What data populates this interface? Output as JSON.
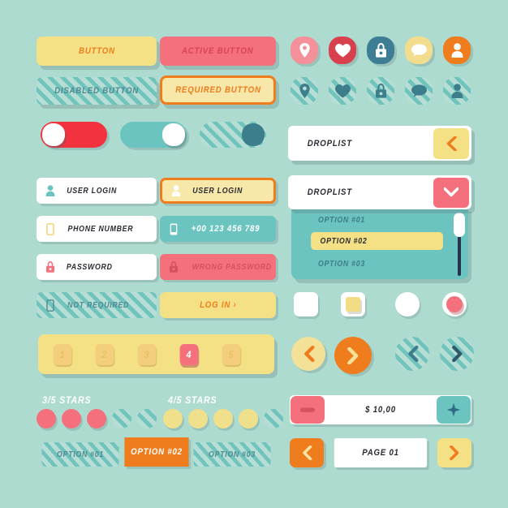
{
  "theme": {
    "background": "#aedbd0",
    "yellow": "#f4e185",
    "pink": "#f4707c",
    "orange": "#f07d1d",
    "teal": "#6bc4bf",
    "teal_dark": "#3d7e87",
    "white": "#ffffff",
    "stripe_light": "#b6ded5",
    "stripe_dark": "#71c3bd"
  },
  "buttons": {
    "normal": "BUTTON",
    "active": "ACTIVE BUTTON",
    "disabled": "DISABLED BUTTON",
    "required": "REQUIRED BUTTON"
  },
  "icons": {
    "enabled": [
      {
        "name": "pin-icon",
        "label": "location",
        "color": "#f4909a"
      },
      {
        "name": "heart-icon",
        "label": "favorite",
        "color": "#d9404d"
      },
      {
        "name": "lock-icon",
        "label": "lock",
        "color": "#3d7e94"
      },
      {
        "name": "chat-icon",
        "label": "message",
        "color": "#f2dd8e"
      },
      {
        "name": "user-icon",
        "label": "profile",
        "color": "#f07d1d"
      }
    ],
    "disabled_note": "disabled striped versions of the same five icons"
  },
  "toggles": [
    {
      "name": "toggle-on-red",
      "state": "off",
      "track": "#f2323f",
      "knob": "#ffffff"
    },
    {
      "name": "toggle-teal",
      "state": "on",
      "track": "#6bc4bf",
      "knob": "#ffffff"
    },
    {
      "name": "toggle-disabled",
      "state": "on",
      "track": "striped",
      "knob": "#3d7e8c"
    }
  ],
  "fields": {
    "left": [
      {
        "name": "user-login-field",
        "label": "USER LOGIN",
        "icon": "user-icon",
        "state": "default"
      },
      {
        "name": "phone-number-field",
        "label": "PHONE NUMBER",
        "icon": "phone-icon",
        "state": "default"
      },
      {
        "name": "password-field",
        "label": "PASSWORD",
        "icon": "lock-icon",
        "state": "default"
      },
      {
        "name": "not-required-field",
        "label": "NOT REQUIRED",
        "icon": "phone-icon",
        "state": "disabled"
      }
    ],
    "right": [
      {
        "name": "user-login-field-focused",
        "label": "USER LOGIN",
        "icon": "user-icon",
        "state": "focused"
      },
      {
        "name": "phone-number-field-filled",
        "label": "+00 123 456 789",
        "icon": "phone-icon",
        "state": "filled"
      },
      {
        "name": "password-field-error",
        "label": "WRONG PASSWORD",
        "icon": "lock-icon",
        "state": "error"
      },
      {
        "name": "login-button",
        "label": "LOG IN ›",
        "icon": "none",
        "state": "cta"
      }
    ]
  },
  "droplist": {
    "collapsed": {
      "label": "DROPLIST",
      "button_icon": "chevron-left-icon",
      "button_color": "#f4e185"
    },
    "expanded": {
      "label": "DROPLIST",
      "button_icon": "chevron-down-icon",
      "button_color": "#f4707c",
      "options": [
        "OPTION #01",
        "OPTION #02",
        "OPTION #03"
      ],
      "selected_index": 1,
      "scrollbar": true
    }
  },
  "pagination": {
    "pages": [
      "1",
      "2",
      "3",
      "4",
      "5"
    ],
    "active_index": 3
  },
  "stars": [
    {
      "name": "rating-3-of-5",
      "label": "3/5 STARS",
      "filled": 3,
      "total": 5,
      "color": "#f4707c"
    },
    {
      "name": "rating-4-of-5",
      "label": "4/5 STARS",
      "filled": 4,
      "total": 5,
      "color": "#f0e08b"
    }
  ],
  "tabs": {
    "items": [
      "OPTION #01",
      "OPTION #02",
      "OPTION #03"
    ],
    "active_index": 1
  },
  "selectors": [
    {
      "name": "checkbox-unchecked",
      "type": "checkbox",
      "checked": false
    },
    {
      "name": "checkbox-checked",
      "type": "checkbox",
      "checked": true
    },
    {
      "name": "radio-unselected",
      "type": "radio",
      "checked": false
    },
    {
      "name": "radio-selected",
      "type": "radio",
      "checked": true
    }
  ],
  "circle_arrows": [
    {
      "name": "prev-circle-button",
      "icon": "chevron-left-icon",
      "bg": "#f2e196",
      "fg": "#f07d1d",
      "state": "enabled"
    },
    {
      "name": "next-circle-button",
      "icon": "chevron-right-icon",
      "bg": "#f07d1d",
      "fg": "#f2e196",
      "state": "enabled"
    },
    {
      "name": "prev-circle-button-disabled",
      "icon": "chevron-left-icon",
      "bg": "striped",
      "fg": "#3d7e8c",
      "state": "disabled"
    },
    {
      "name": "next-circle-button-disabled",
      "icon": "chevron-right-icon",
      "bg": "striped",
      "fg": "#2f5a6b",
      "state": "disabled"
    }
  ],
  "steppers": {
    "price": {
      "name": "price-stepper",
      "value": "$ 10,00",
      "minus_color": "#f4707c",
      "plus_color": "#6bc4bf"
    },
    "page": {
      "name": "page-stepper",
      "value": "PAGE 01",
      "prev_color": "#f07d1d",
      "next_color": "#f4e185"
    }
  }
}
